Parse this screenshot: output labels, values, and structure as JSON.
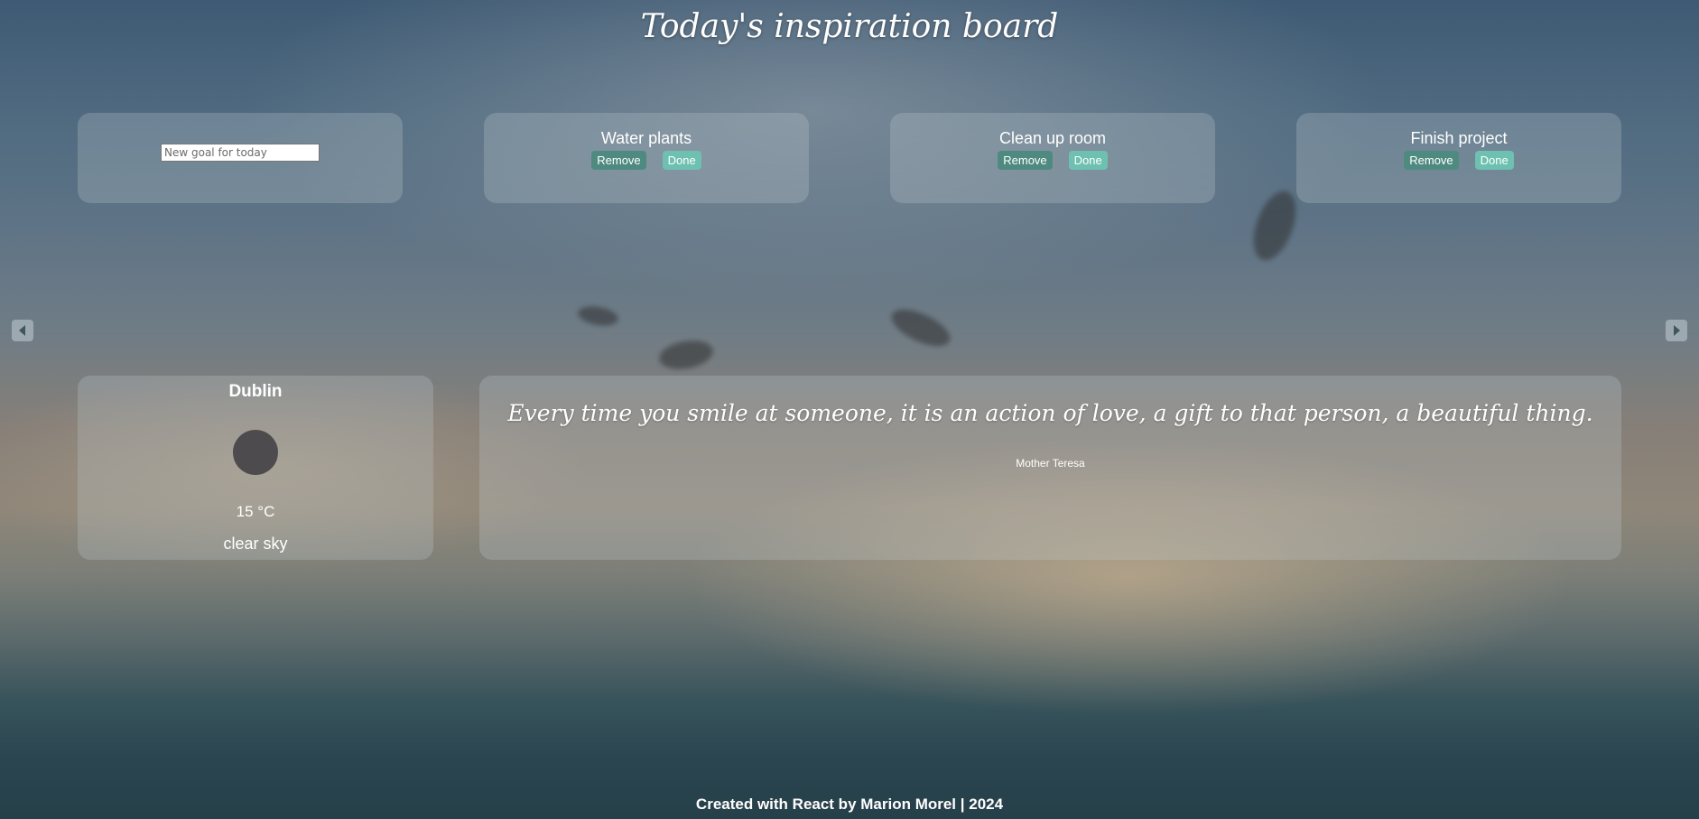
{
  "page": {
    "title": "Today's inspiration board"
  },
  "goals": {
    "input_placeholder": "New goal for today",
    "input_value": "",
    "items": [
      {
        "title": "Water plants",
        "remove_label": "Remove",
        "done_label": "Done"
      },
      {
        "title": "Clean up room",
        "remove_label": "Remove",
        "done_label": "Done"
      },
      {
        "title": "Finish project",
        "remove_label": "Remove",
        "done_label": "Done"
      }
    ]
  },
  "navigation": {
    "prev_icon": "caret-left-icon",
    "next_icon": "caret-right-icon"
  },
  "weather": {
    "city": "Dublin",
    "icon": "weather-icon",
    "temperature": "15 °C",
    "description": "clear sky"
  },
  "quote": {
    "text": "Every time you smile at someone, it is an action of love, a gift to that person, a beautiful thing.",
    "author": "Mother Teresa"
  },
  "footer": {
    "text": "Created with React by Marion Morel | 2024"
  },
  "colors": {
    "remove_button": "#4f8a80",
    "done_button": "#6ec0b1",
    "card_background": "rgba(190,200,205,0.28)"
  }
}
